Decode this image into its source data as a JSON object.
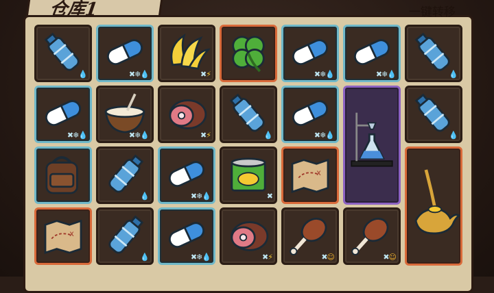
{
  "header": {
    "title": "仓库1",
    "transfer_label": "一键转移"
  },
  "colors": {
    "rare_border": "#6fb8c9",
    "epic_border": "#d96a3a",
    "legendary_border": "#8c62c2"
  },
  "grid": {
    "rows": [
      [
        "water-bottle",
        "pill-capsule",
        "banana-bunch",
        "four-leaf-clover",
        "pill-capsule",
        "pill-capsule",
        "water-bottle"
      ],
      [
        "pill-capsule",
        "coconut-drink",
        "ham-meat",
        "water-bottle",
        "pill-capsule",
        "lab-flask-stand",
        "water-bottle"
      ],
      [
        "leather-backpack",
        "water-bottle",
        "pill-capsule",
        "tin-can",
        "treasure-map",
        "",
        "magic-lamp"
      ],
      [
        "treasure-map",
        "water-bottle",
        "pill-capsule",
        "ham-meat",
        "chicken-drumstick",
        "chicken-drumstick",
        ""
      ]
    ]
  }
}
